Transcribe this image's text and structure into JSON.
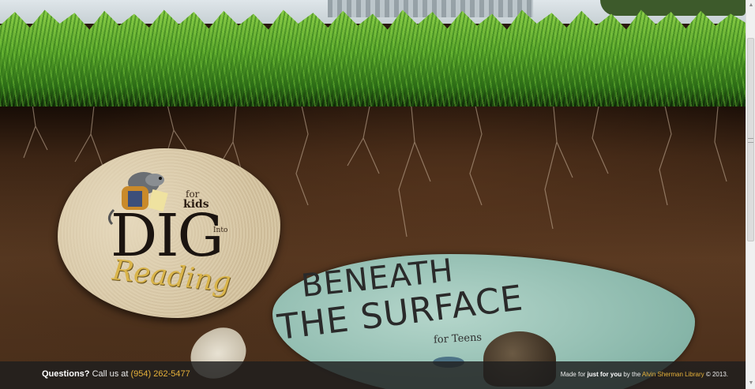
{
  "footer": {
    "questions_label": "Questions?",
    "call_text": "Call us at",
    "phone": "(954) 262-5477",
    "made_for": "Made for",
    "just_for_you": "just for you",
    "by_the": "by the",
    "library_name": "Alvin Sherman Library",
    "copyright": "© 2013."
  },
  "kids_stone": {
    "for": "for",
    "kids": "kids",
    "dig": "DIG",
    "into": "Into",
    "reading": "Reading"
  },
  "teens_pond": {
    "beneath": "BENEATH",
    "surface": "THE SURFACE",
    "for_teens": "for Teens"
  },
  "scrollbar": {
    "up_icon": "chevron-up-icon",
    "down_icon": "chevron-down-icon"
  }
}
